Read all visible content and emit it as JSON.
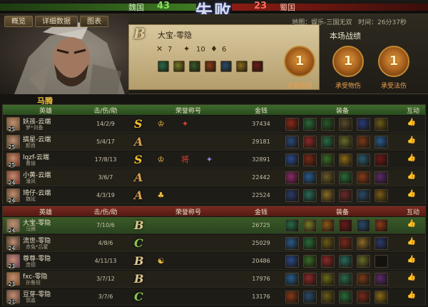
{
  "top": {
    "wei_name": "魏国",
    "wei_score": "43",
    "shu_name": "蜀国",
    "shu_score": "23",
    "emblem": "失败"
  },
  "tabs": [
    "概览",
    "详细数据",
    "图表"
  ],
  "map_info": {
    "map": "地图：娱乐-三国无双",
    "time": "时间：26分37秒"
  },
  "hero_card": {
    "grade": "B",
    "title": "大宝-零隐",
    "kills": "7",
    "deaths": "10",
    "assists": "6",
    "equipment_colors": [
      "#2a6a4a",
      "#7a7a2a",
      "#3a5a2a",
      "#8a3a1a",
      "#2a4a6a",
      "#8a6a1a",
      "#6a1a1a"
    ]
  },
  "player_tag": "马腾",
  "battle_record": {
    "title": "本场战绩",
    "badges": [
      {
        "num": "1",
        "label": "无敌肉盾"
      },
      {
        "num": "1",
        "label": "承受物伤"
      },
      {
        "num": "1",
        "label": "承受法伤"
      }
    ]
  },
  "headers": {
    "hero": "英雄",
    "kda": "击/伤/助",
    "honor": "荣誉称号",
    "gold": "金钱",
    "equip": "装备",
    "interact": "互动"
  },
  "teams": [
    {
      "rows": [
        {
          "player": "妖孩-云端",
          "hero": "梦*刘备",
          "level": "25",
          "kda": "14/2/9",
          "grade": "S",
          "honors": [
            "♔",
            "✦"
          ],
          "gold": "37434",
          "avatar": "#6a5030",
          "items": [
            "#8a2a1a",
            "#2a6a3a",
            "#2a5a2a",
            "#5a4a2a",
            "#2a3a7a",
            "#6a5a1a"
          ]
        },
        {
          "player": "搞星-云端",
          "hero": "颜良",
          "level": "25",
          "kda": "5/4/17",
          "grade": "A",
          "honors": [],
          "gold": "29181",
          "avatar": "#4a3a2a",
          "items": [
            "#2a4a7a",
            "#8a2a2a",
            "#2a6a4a",
            "#6a6a2a",
            "#7a3a1a",
            "#2a5a8a"
          ]
        },
        {
          "player": "lqzf-云端",
          "hero": "曹操",
          "level": "25",
          "kda": "17/8/13",
          "grade": "S",
          "honors": [
            "♔",
            "将",
            "✦"
          ],
          "gold": "32891",
          "avatar": "#6a2a1a",
          "items": [
            "#2a4a8a",
            "#7a2a1a",
            "#3a6a2a",
            "#8a6a1a",
            "#2a5a6a",
            "#6a1a1a"
          ]
        },
        {
          "player": "小黄-云端",
          "hero": "潘凤",
          "level": "24",
          "kda": "3/6/7",
          "grade": "A",
          "honors": [],
          "gold": "22442",
          "avatar": "#7a2a2a",
          "items": [
            "#8a2a6a",
            "#2a5a8a",
            "#6a5a2a",
            "#2a6a3a",
            "#8a3a1a",
            "#5a2a6a"
          ]
        },
        {
          "player": "琦仔-云端",
          "hero": "魏延",
          "level": "24",
          "kda": "4/3/19",
          "grade": "A",
          "honors": [
            "♣"
          ],
          "gold": "22524",
          "avatar": "#5a3a2a",
          "items": [
            "#2a3a6a",
            "#2a6a5a",
            "#8a6a2a",
            "#6a2a2a",
            "#2a4a6a",
            "#7a5a1a"
          ]
        }
      ]
    },
    {
      "rows": [
        {
          "player": "大宝-零隐",
          "hero": "马腾",
          "level": "24",
          "kda": "7/10/6",
          "grade": "B",
          "honors": [],
          "gold": "26725",
          "avatar": "#6a5a4a",
          "items": [
            "#2a6a4a",
            "#7a7a2a",
            "#8a5a1a",
            "#6a1a1a",
            "#2a4a6a",
            "#8a3a1a"
          ]
        },
        {
          "player": "流世-零隐",
          "hero": "赤兔*吕蒙",
          "level": "24",
          "kda": "4/8/6",
          "grade": "C",
          "honors": [],
          "gold": "25029",
          "avatar": "#3a2a2a",
          "items": [
            "#2a5a8a",
            "#2a6a3a",
            "#6a5a1a",
            "#7a2a1a",
            "#8a6a2a",
            "#2a3a6a"
          ]
        },
        {
          "player": "尊尊-零隐",
          "hero": "庞德",
          "level": "23",
          "kda": "4/11/13",
          "grade": "B",
          "honors": [
            "☯"
          ],
          "gold": "20486",
          "avatar": "#6a3a5a",
          "items": [
            "#2a4a8a",
            "#3a6a2a",
            "#8a2a2a",
            "#2a6a5a",
            "#6a6a2a",
            "EMPTY"
          ]
        },
        {
          "player": "fxc-零隐",
          "hero": "孙鲁班",
          "level": "23",
          "kda": "3/7/12",
          "grade": "B",
          "honors": [],
          "gold": "17976",
          "avatar": "#7a4a2a",
          "items": [
            "#2a5a8a",
            "#8a2a2a",
            "#6a6a1a",
            "#2a6a4a",
            "#7a3a1a",
            "#5a2a6a"
          ]
        },
        {
          "player": "豆芽-零隐",
          "hero": "郭嘉",
          "level": "21",
          "kda": "3/7/6",
          "grade": "C",
          "honors": [],
          "gold": "13176",
          "avatar": "#5a3a3a",
          "items": [
            "#8a3a1a",
            "#2a4a6a",
            "#6a5a1a",
            "#2a6a3a",
            "#7a2a1a",
            "#8a6a1a"
          ]
        }
      ]
    }
  ]
}
